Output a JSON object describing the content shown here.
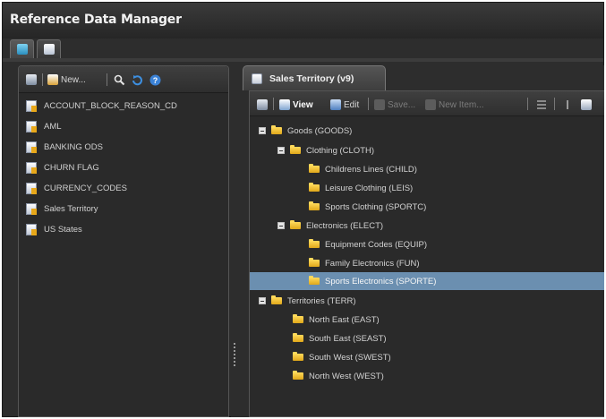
{
  "window": {
    "title": "Reference Data Manager"
  },
  "app_tabs": [
    {
      "name": "tab-data",
      "icon": "table-icon"
    },
    {
      "name": "tab-manager",
      "icon": "document-icon"
    }
  ],
  "left_toolbar": {
    "save_icon": "save-icon",
    "new_label": "New...",
    "search_icon": "search-icon",
    "refresh_icon": "refresh-icon",
    "help_icon": "help-icon"
  },
  "reference_lists": [
    {
      "label": "ACCOUNT_BLOCK_REASON_CD"
    },
    {
      "label": "AML"
    },
    {
      "label": "BANKING ODS"
    },
    {
      "label": "CHURN FLAG"
    },
    {
      "label": "CURRENCY_CODES"
    },
    {
      "label": "Sales Territory"
    },
    {
      "label": "US States"
    }
  ],
  "document_tab": {
    "label": "Sales Territory (v9)"
  },
  "doc_toolbar": {
    "view_label": "View",
    "edit_label": "Edit",
    "save_label": "Save...",
    "new_item_label": "New Item..."
  },
  "tree": [
    {
      "label": "Goods (GOODS)",
      "level": 0,
      "expander": true
    },
    {
      "label": "Clothing (CLOTH)",
      "level": 1,
      "expander": true
    },
    {
      "label": "Childrens Lines (CHILD)",
      "level": 2,
      "expander": false
    },
    {
      "label": "Leisure Clothing (LEIS)",
      "level": 2,
      "expander": false
    },
    {
      "label": "Sports Clothing (SPORTC)",
      "level": 2,
      "expander": false
    },
    {
      "label": "Electronics (ELECT)",
      "level": 1,
      "expander": true
    },
    {
      "label": "Equipment Codes (EQUIP)",
      "level": 2,
      "expander": false
    },
    {
      "label": "Family Electronics (FUN)",
      "level": 2,
      "expander": false
    },
    {
      "label": "Sports Electronics (SPORTE)",
      "level": 2,
      "expander": false,
      "selected": true
    },
    {
      "label": "Territories (TERR)",
      "level": 0,
      "expander": true
    },
    {
      "label": "North East (EAST)",
      "level": 1,
      "expander": false
    },
    {
      "label": "South East (SEAST)",
      "level": 1,
      "expander": false
    },
    {
      "label": "South West (SWEST)",
      "level": 1,
      "expander": false
    },
    {
      "label": "North West (WEST)",
      "level": 1,
      "expander": false
    }
  ],
  "colors": {
    "selection": "#6b8fb0",
    "folder": "#e0a81a",
    "background": "#2d2d2d"
  }
}
